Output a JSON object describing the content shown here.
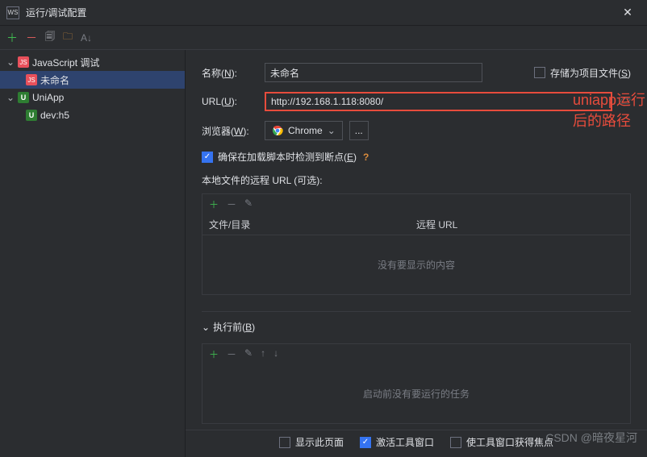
{
  "titlebar": {
    "title": "运行/调试配置"
  },
  "sidebar": {
    "groups": [
      {
        "label": "JavaScript 调试",
        "children": [
          {
            "label": "未命名"
          }
        ]
      },
      {
        "label": "UniApp",
        "children": [
          {
            "label": "dev:h5"
          }
        ]
      }
    ]
  },
  "form": {
    "name_label": "名称",
    "name_mnemonic": "N",
    "name_value": "未命名",
    "save_as_project": "存储为项目文件",
    "save_as_project_mnemonic": "S",
    "url_label": "URL",
    "url_mnemonic": "U",
    "url_value": "http://192.168.1.118:8080/",
    "browser_label": "浏览器",
    "browser_mnemonic": "W",
    "browser_value": "Chrome",
    "more_button": "...",
    "breakpoint_label": "确保在加载脚本时检测到断点",
    "breakpoint_mnemonic": "E",
    "remote_url_section": "本地文件的远程 URL (可选):",
    "table": {
      "col1": "文件/目录",
      "col2": "远程 URL",
      "empty": "没有要显示的内容"
    },
    "before_launch_label": "执行前",
    "before_launch_mnemonic": "B",
    "before_launch_empty": "启动前没有要运行的任务"
  },
  "footer": {
    "show_page": "显示此页面",
    "activate_tool": "激活工具窗口",
    "focus_tool": "使工具窗口获得焦点"
  },
  "annotation": "uniapp运行后的路径",
  "watermark": "CSDN @暗夜星河",
  "colors": {
    "accent": "#3573f0",
    "highlight": "#e74c3c"
  }
}
